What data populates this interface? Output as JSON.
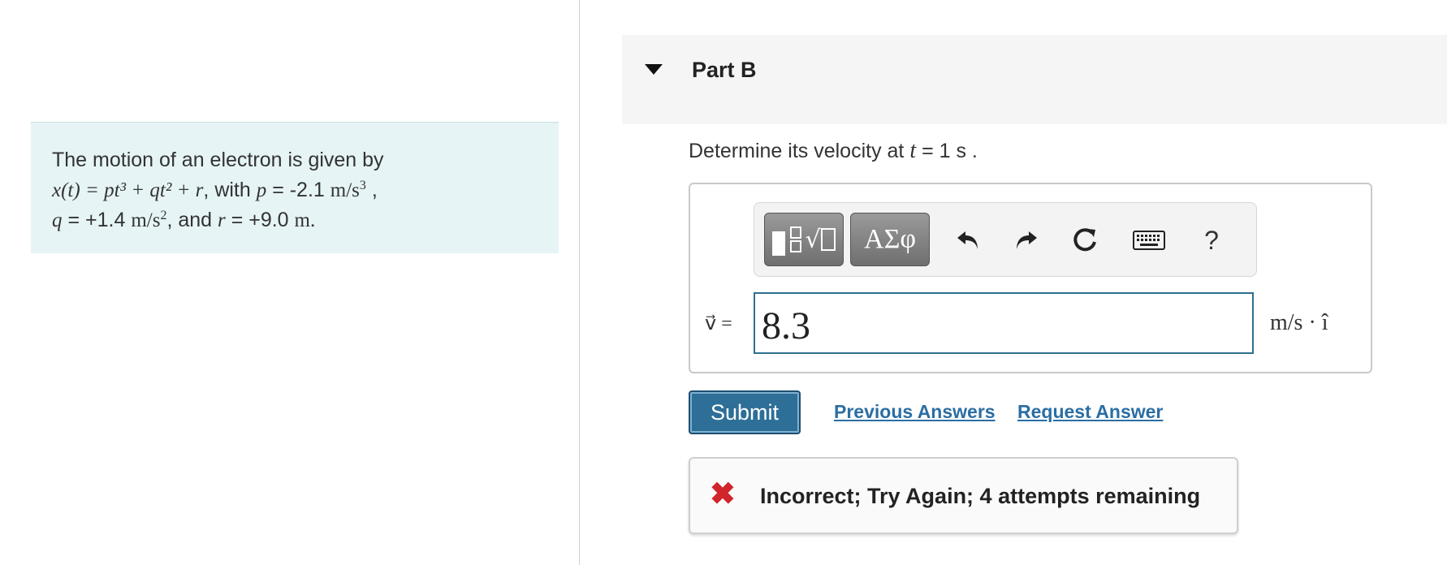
{
  "problem": {
    "intro": "The motion of an electron is given by",
    "equation": "x(t) = pt³ + qt² + r",
    "with_text": ", with",
    "p_var": "p",
    "p_value": "= -2.1",
    "p_unit": "m/s",
    "p_exp": "3",
    "q_var": "q",
    "q_value": "= +1.4",
    "q_unit": "m/s",
    "q_exp": "2",
    "and_text": ", and",
    "r_var": "r",
    "r_value": "= +9.0",
    "r_unit": "m."
  },
  "part": {
    "title": "Part B"
  },
  "question": {
    "text_before": "Determine its velocity at",
    "t_var": "t",
    "text_after": "= 1 s ."
  },
  "toolbar": {
    "greek_label": "ΑΣφ",
    "help_label": "?",
    "icons": [
      "templates-icon",
      "greek-letters-icon",
      "undo-icon",
      "redo-icon",
      "reset-icon",
      "keyboard-icon",
      "help-icon"
    ]
  },
  "answer": {
    "variable_label": "v⃗ =",
    "value": "8.3",
    "units": "m/s · î"
  },
  "actions": {
    "submit_label": "Submit",
    "previous_answers_label": "Previous Answers",
    "request_answer_label": "Request Answer"
  },
  "feedback": {
    "message": "Incorrect; Try Again; 4 attempts remaining",
    "status_color": "#d0252b"
  },
  "colors": {
    "problem_bg": "#e6f4f6",
    "submit_bg": "#2e6f97",
    "link": "#2b6ea3",
    "input_border": "#2e6f8e"
  }
}
